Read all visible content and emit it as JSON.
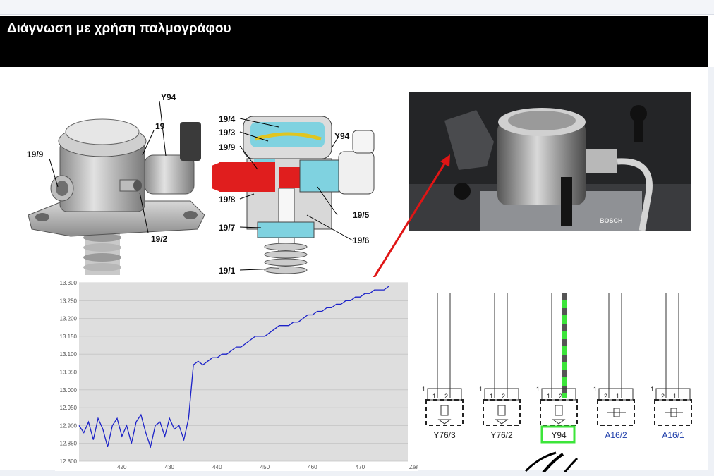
{
  "slide": {
    "title": "Διάγνωση με χρήση παλμογράφου"
  },
  "pump_left": {
    "labels": {
      "y94": "Y94",
      "p19": "19",
      "p19_9": "19/9",
      "p19_2": "19/2"
    }
  },
  "pump_section": {
    "labels": {
      "p19_4": "19/4",
      "p19_3": "19/3",
      "p19_9": "19/9",
      "y94": "Y94",
      "p19_8": "19/8",
      "p19_7": "19/7",
      "p19_5": "19/5",
      "p19_6": "19/6",
      "p19_1": "19/1"
    }
  },
  "photo": {
    "brand": "BOSCH"
  },
  "chart_data": {
    "type": "line",
    "x_ticks": [
      "420",
      "430",
      "440",
      "450",
      "460",
      "470",
      "Zeit [s"
    ],
    "y_ticks": [
      "13.300",
      "13.250",
      "13.200",
      "13.150",
      "13.100",
      "13.050",
      "13.000",
      "12.950",
      "12.900",
      "12.850",
      "12.800"
    ],
    "xlim": [
      411,
      480
    ],
    "ylim": [
      12.8,
      13.3
    ],
    "series": [
      {
        "color": "#1c22c8",
        "values": [
          [
            411,
            12.9
          ],
          [
            412,
            12.88
          ],
          [
            413,
            12.91
          ],
          [
            414,
            12.86
          ],
          [
            415,
            12.92
          ],
          [
            416,
            12.89
          ],
          [
            417,
            12.84
          ],
          [
            418,
            12.9
          ],
          [
            419,
            12.92
          ],
          [
            420,
            12.87
          ],
          [
            421,
            12.9
          ],
          [
            422,
            12.85
          ],
          [
            423,
            12.91
          ],
          [
            424,
            12.93
          ],
          [
            425,
            12.88
          ],
          [
            426,
            12.84
          ],
          [
            427,
            12.9
          ],
          [
            428,
            12.91
          ],
          [
            429,
            12.87
          ],
          [
            430,
            12.92
          ],
          [
            431,
            12.89
          ],
          [
            432,
            12.9
          ],
          [
            433,
            12.86
          ],
          [
            434,
            12.92
          ],
          [
            435,
            13.07
          ],
          [
            436,
            13.08
          ],
          [
            437,
            13.07
          ],
          [
            438,
            13.08
          ],
          [
            439,
            13.09
          ],
          [
            440,
            13.09
          ],
          [
            441,
            13.1
          ],
          [
            442,
            13.1
          ],
          [
            443,
            13.11
          ],
          [
            444,
            13.12
          ],
          [
            445,
            13.12
          ],
          [
            446,
            13.13
          ],
          [
            447,
            13.14
          ],
          [
            448,
            13.15
          ],
          [
            449,
            13.15
          ],
          [
            450,
            13.15
          ],
          [
            451,
            13.16
          ],
          [
            452,
            13.17
          ],
          [
            453,
            13.18
          ],
          [
            454,
            13.18
          ],
          [
            455,
            13.18
          ],
          [
            456,
            13.19
          ],
          [
            457,
            13.19
          ],
          [
            458,
            13.2
          ],
          [
            459,
            13.21
          ],
          [
            460,
            13.21
          ],
          [
            461,
            13.22
          ],
          [
            462,
            13.22
          ],
          [
            463,
            13.23
          ],
          [
            464,
            13.23
          ],
          [
            465,
            13.24
          ],
          [
            466,
            13.24
          ],
          [
            467,
            13.25
          ],
          [
            468,
            13.25
          ],
          [
            469,
            13.26
          ],
          [
            470,
            13.26
          ],
          [
            471,
            13.27
          ],
          [
            472,
            13.27
          ],
          [
            473,
            13.28
          ],
          [
            474,
            13.28
          ],
          [
            475,
            13.28
          ],
          [
            476,
            13.29
          ]
        ]
      }
    ]
  },
  "wiring": {
    "components": [
      {
        "name": "Y76/3",
        "color": "#222222",
        "pin_left": "1",
        "pin_right": "2"
      },
      {
        "name": "Y76/2",
        "color": "#222222",
        "pin_left": "1",
        "pin_right": "2"
      },
      {
        "name": "Y94",
        "color": "#222222",
        "pin_left": "1",
        "pin_right": "2",
        "highlight": "#3ce53a"
      },
      {
        "name": "A16/2",
        "color": "#1a3aa8",
        "pin_left": "2",
        "pin_right": "1"
      },
      {
        "name": "A16/1",
        "color": "#1a3aa8",
        "pin_left": "2",
        "pin_right": "1"
      }
    ],
    "outer_pin_label": "1"
  }
}
